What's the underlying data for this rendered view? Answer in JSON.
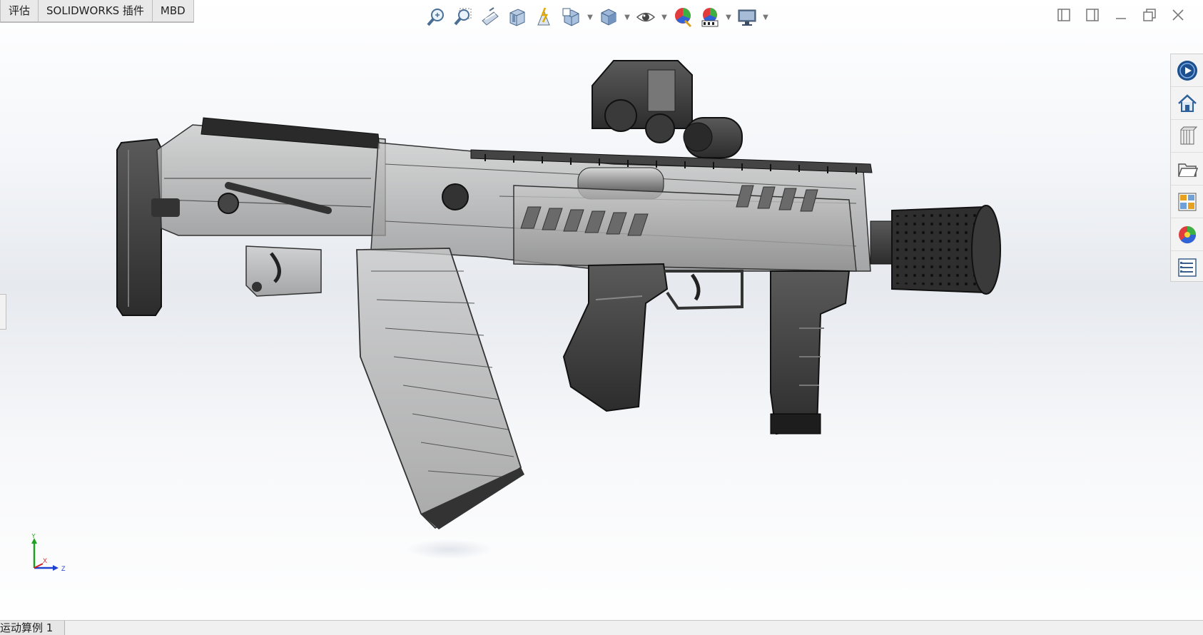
{
  "tabs": [
    "评估",
    "SOLIDWORKS 插件",
    "MBD"
  ],
  "hud_tools": [
    {
      "icon": "zoom-to-fit-icon"
    },
    {
      "icon": "zoom-to-area-icon"
    },
    {
      "icon": "previous-view-icon"
    },
    {
      "icon": "section-view-icon"
    },
    {
      "icon": "dynamic-annotation-icon"
    },
    {
      "icon": "view-orientation-icon",
      "dropdown": true
    },
    {
      "icon": "display-style-icon",
      "dropdown": true
    },
    {
      "icon": "hide-show-items-icon",
      "dropdown": true
    },
    {
      "icon": "edit-appearance-icon"
    },
    {
      "icon": "apply-scene-icon",
      "dropdown": true
    },
    {
      "icon": "view-settings-icon",
      "dropdown": true
    }
  ],
  "window_controls": [
    "tile-left-icon",
    "tile-right-icon",
    "minimize-icon",
    "restore-icon",
    "close-icon"
  ],
  "task_pane": [
    {
      "icon": "solidworks-resources-icon"
    },
    {
      "icon": "home-icon"
    },
    {
      "icon": "design-library-icon"
    },
    {
      "icon": "file-explorer-icon"
    },
    {
      "icon": "view-palette-icon"
    },
    {
      "icon": "appearances-scenes-icon"
    },
    {
      "icon": "custom-properties-icon"
    }
  ],
  "triad": {
    "x_label": "X",
    "y_label": "Y",
    "z_label": "Z"
  },
  "bottom_tab": "运动算例 1",
  "colors": {
    "axis_x": "#d02020",
    "axis_y": "#20a020",
    "axis_z": "#2040d0",
    "accent": "#1f5fa8"
  }
}
